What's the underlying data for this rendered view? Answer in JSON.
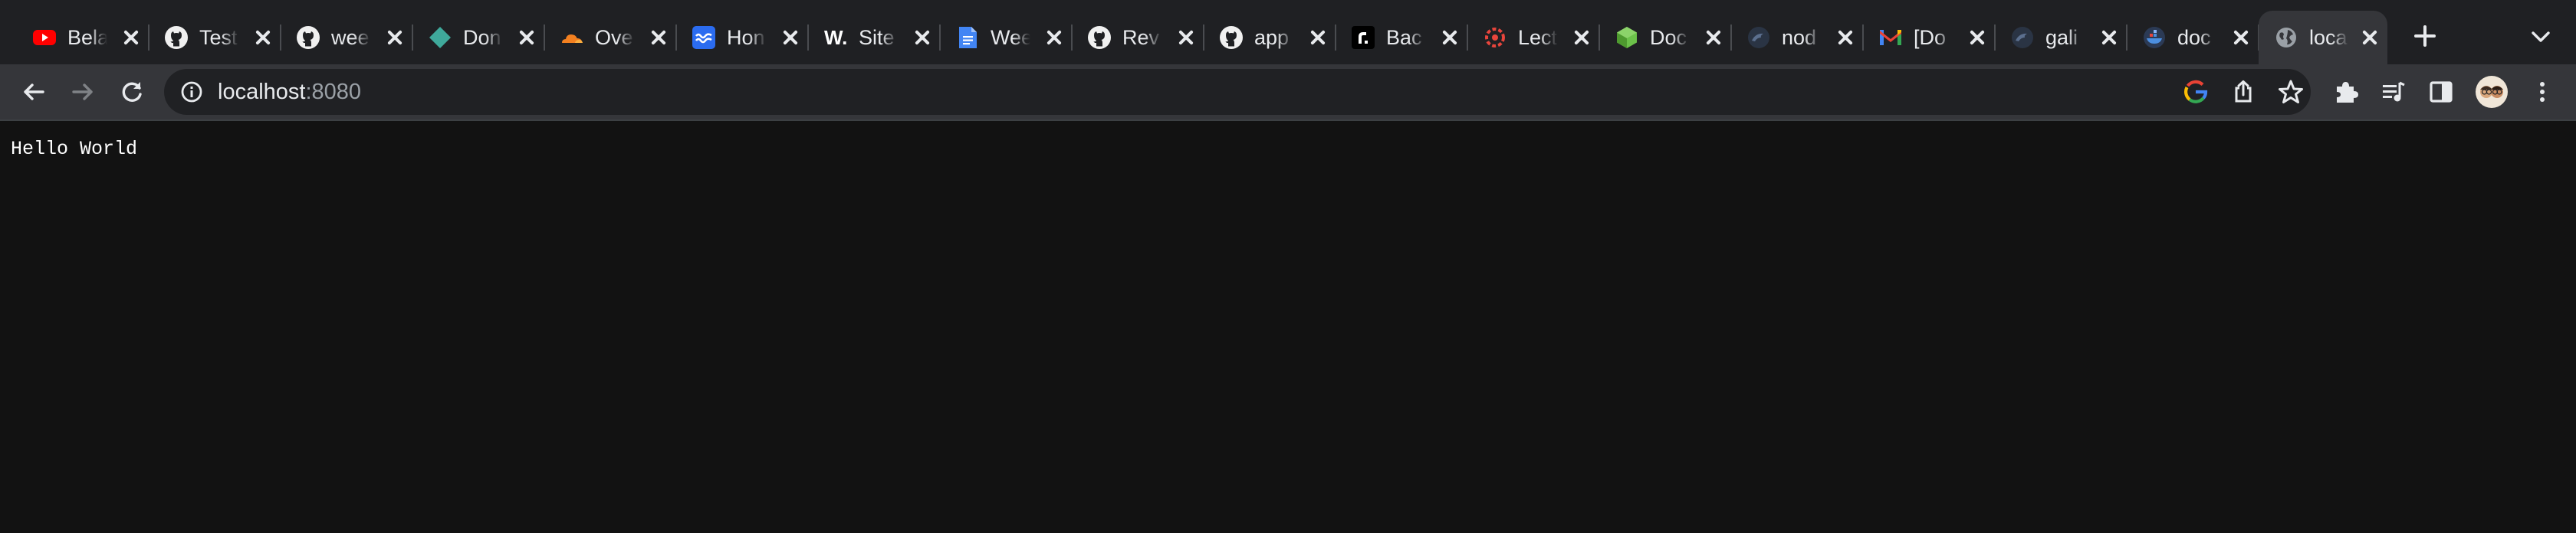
{
  "tabs": [
    {
      "title": "Bela",
      "icon": "youtube-icon"
    },
    {
      "title": "Test",
      "icon": "github-icon"
    },
    {
      "title": "wee",
      "icon": "github-icon"
    },
    {
      "title": "Don",
      "icon": "diamond-icon"
    },
    {
      "title": "Ove",
      "icon": "cloudflare-icon"
    },
    {
      "title": "Hon",
      "icon": "waves-icon"
    },
    {
      "title": "Site",
      "icon": "webflow-icon"
    },
    {
      "title": "Wee",
      "icon": "google-docs-icon"
    },
    {
      "title": "Rev",
      "icon": "github-icon"
    },
    {
      "title": "app",
      "icon": "github-icon"
    },
    {
      "title": "Bac",
      "icon": "render-icon"
    },
    {
      "title": "Lect",
      "icon": "ring-icon"
    },
    {
      "title": "Doc",
      "icon": "nodejs-icon"
    },
    {
      "title": "nod",
      "icon": "bird-icon"
    },
    {
      "title": "[Do",
      "icon": "gmail-icon"
    },
    {
      "title": "gali",
      "icon": "bird-icon"
    },
    {
      "title": "doc",
      "icon": "docker-icon"
    },
    {
      "title": "loca",
      "icon": "globe-icon",
      "active": true
    }
  ],
  "toolbar": {
    "url_host": "localhost",
    "url_port": ":8080"
  },
  "page": {
    "text": "Hello World"
  },
  "colors": {
    "tabstrip_bg": "#1f2023",
    "toolbar_bg": "#35363a",
    "omnibox_bg": "#202124",
    "page_bg": "#121212",
    "text": "#e8eaed"
  }
}
